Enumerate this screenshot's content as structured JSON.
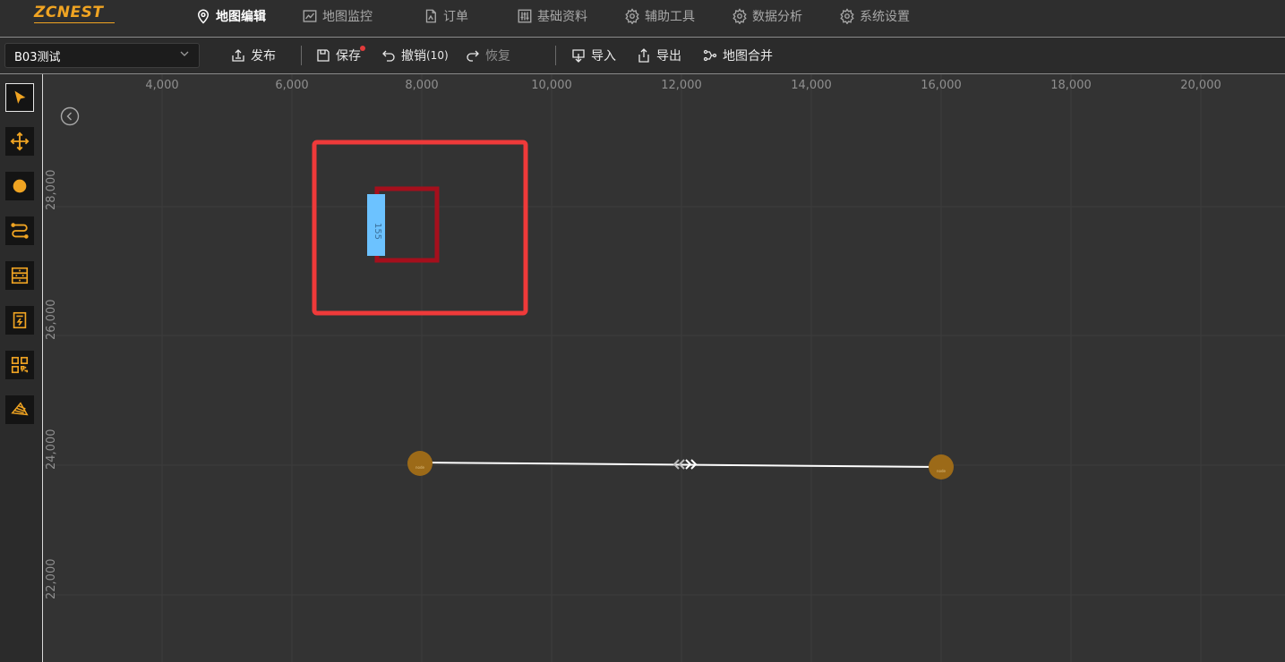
{
  "app": {
    "logo_text": "ZCNEST",
    "brand_color": "#f0a422"
  },
  "nav": {
    "items": [
      {
        "label": "地图编辑",
        "icon": "location-pin-icon",
        "active": true
      },
      {
        "label": "地图监控",
        "icon": "line-chart-icon"
      },
      {
        "label": "订单",
        "icon": "document-icon"
      },
      {
        "label": "基础资料",
        "icon": "sliders-icon"
      },
      {
        "label": "辅助工具",
        "icon": "gear-icon"
      },
      {
        "label": "数据分析",
        "icon": "gear-icon"
      },
      {
        "label": "系统设置",
        "icon": "gear-icon"
      }
    ]
  },
  "toolbar": {
    "map_select": {
      "value": "B03测试",
      "icon": "chevron-down-icon"
    },
    "publish_label": "发布",
    "save_label": "保存",
    "undo_label": "撤销",
    "undo_count": "(10)",
    "redo_label": "恢复",
    "import_label": "导入",
    "export_label": "导出",
    "merge_label": "地图合并",
    "unsaved_indicator_color": "#e23b3b"
  },
  "left_tools": [
    {
      "name": "select-tool",
      "icon": "pointer-arrow-icon",
      "active": true
    },
    {
      "name": "move-tool",
      "icon": "move-arrows-icon"
    },
    {
      "name": "point-tool",
      "icon": "dot-icon"
    },
    {
      "name": "path-tool",
      "icon": "route-icon"
    },
    {
      "name": "shelf-tool",
      "icon": "shelf-icon"
    },
    {
      "name": "charger-tool",
      "icon": "charging-station-icon"
    },
    {
      "name": "qrcode-tool",
      "icon": "qr-code-icon"
    },
    {
      "name": "area-tool",
      "icon": "area-layers-icon"
    }
  ],
  "map": {
    "x_ticks": [
      "4,000",
      "6,000",
      "8,000",
      "10,000",
      "12,000",
      "14,000",
      "16,000",
      "18,000",
      "20,000"
    ],
    "y_ticks": [
      "28,000",
      "26,000",
      "24,000",
      "22,000"
    ],
    "shelf_label": "155",
    "colors": {
      "area_outline": "#ef3a3a",
      "shelf_outline": "#a50f1c",
      "shelf_marker": "#6cc2ff",
      "node_fill": "#9c6a18",
      "path_line": "#ffffff",
      "grid": "#3d3d3d"
    }
  }
}
